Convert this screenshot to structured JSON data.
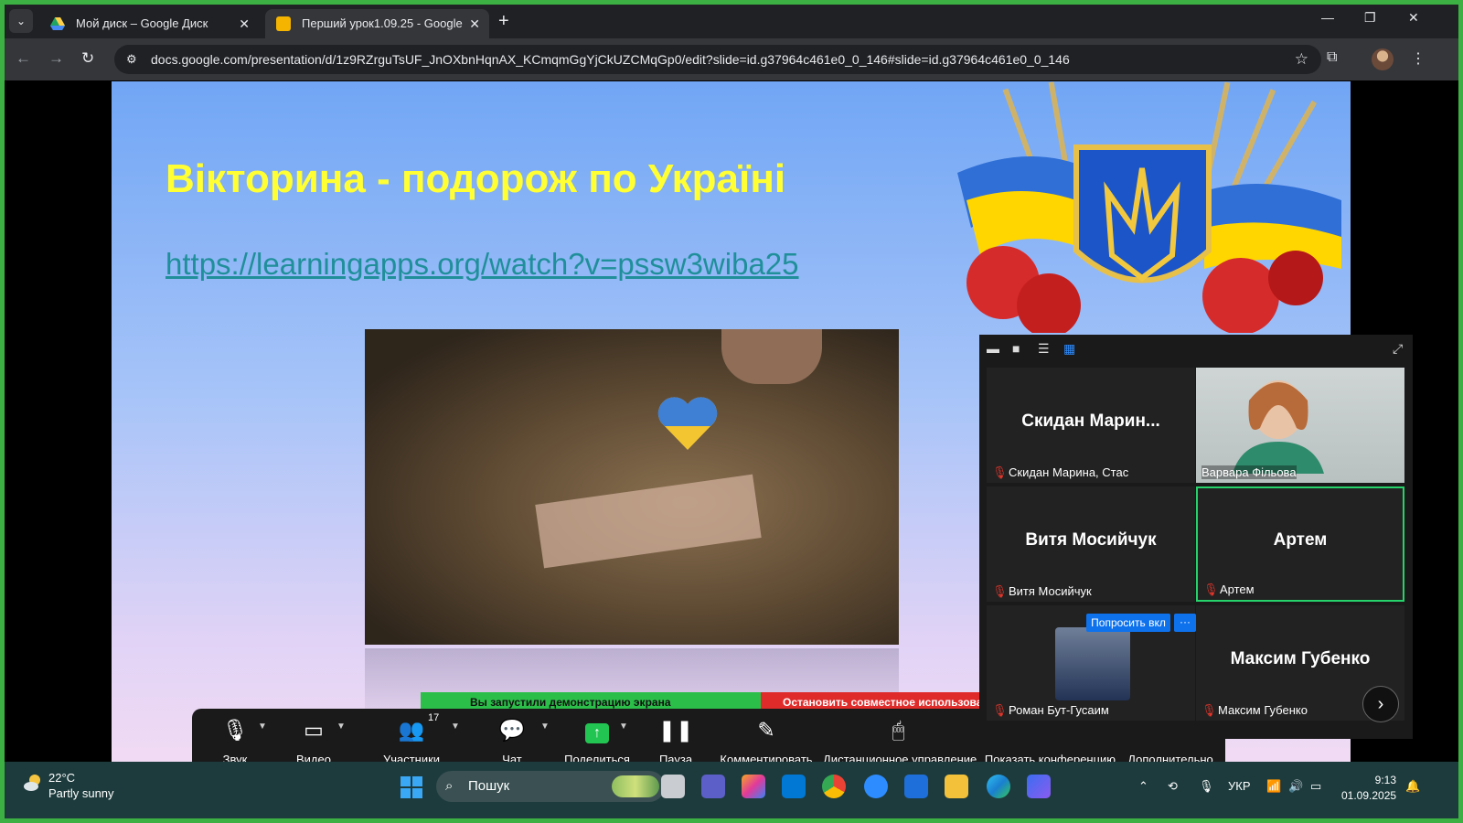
{
  "browser": {
    "tabs": [
      {
        "label": "Мой диск – Google Диск",
        "icon": "google-drive-icon"
      },
      {
        "label": "Перший урок1.09.25 - Google",
        "icon": "google-slides-icon"
      }
    ],
    "url": "docs.google.com/presentation/d/1z9RZrguTsUF_JnOXbnHqnAX_KCmqmGgYjCkUZCMqGp0/edit?slide=id.g37964c461e0_0_146#slide=id.g37964c461e0_0_146"
  },
  "slide": {
    "title": "Вікторина - подорож по Україні",
    "link": "https://learningapps.org/watch?v=pssw3wiba25"
  },
  "share_banner": {
    "status": "Вы запустили демонстрацию экрана",
    "stop": "Остановить совместное использование"
  },
  "zoom_controls": {
    "audio": "Звук",
    "video": "Видео",
    "participants": "Участники",
    "participants_count": "17",
    "chat": "Чат",
    "share": "Поделиться",
    "pause": "Пауза",
    "annotate": "Комментировать",
    "remote_control": "Дистанционное управление",
    "show_conference": "Показать конференцию",
    "more": "Дополнительно"
  },
  "gallery": {
    "tiles": [
      {
        "big": "Скидан  Марин...",
        "name": "Скидан Марина, Стас"
      },
      {
        "big": "",
        "name": "Варвара Фільова"
      },
      {
        "big": "Витя Мосийчук",
        "name": "Витя Мосийчук"
      },
      {
        "big": "Артем",
        "name": "Артем"
      },
      {
        "big": "",
        "name": "Роман Бут-Гусаим"
      },
      {
        "big": "Максим Губенко",
        "name": "Максим Губенко"
      }
    ],
    "ask_button": "Попросить вкл",
    "ask_more": "···"
  },
  "taskbar": {
    "temperature": "22°C",
    "condition": "Partly sunny",
    "search_placeholder": "Пошук",
    "language": "УКР",
    "time": "9:13",
    "date": "01.09.2025"
  }
}
